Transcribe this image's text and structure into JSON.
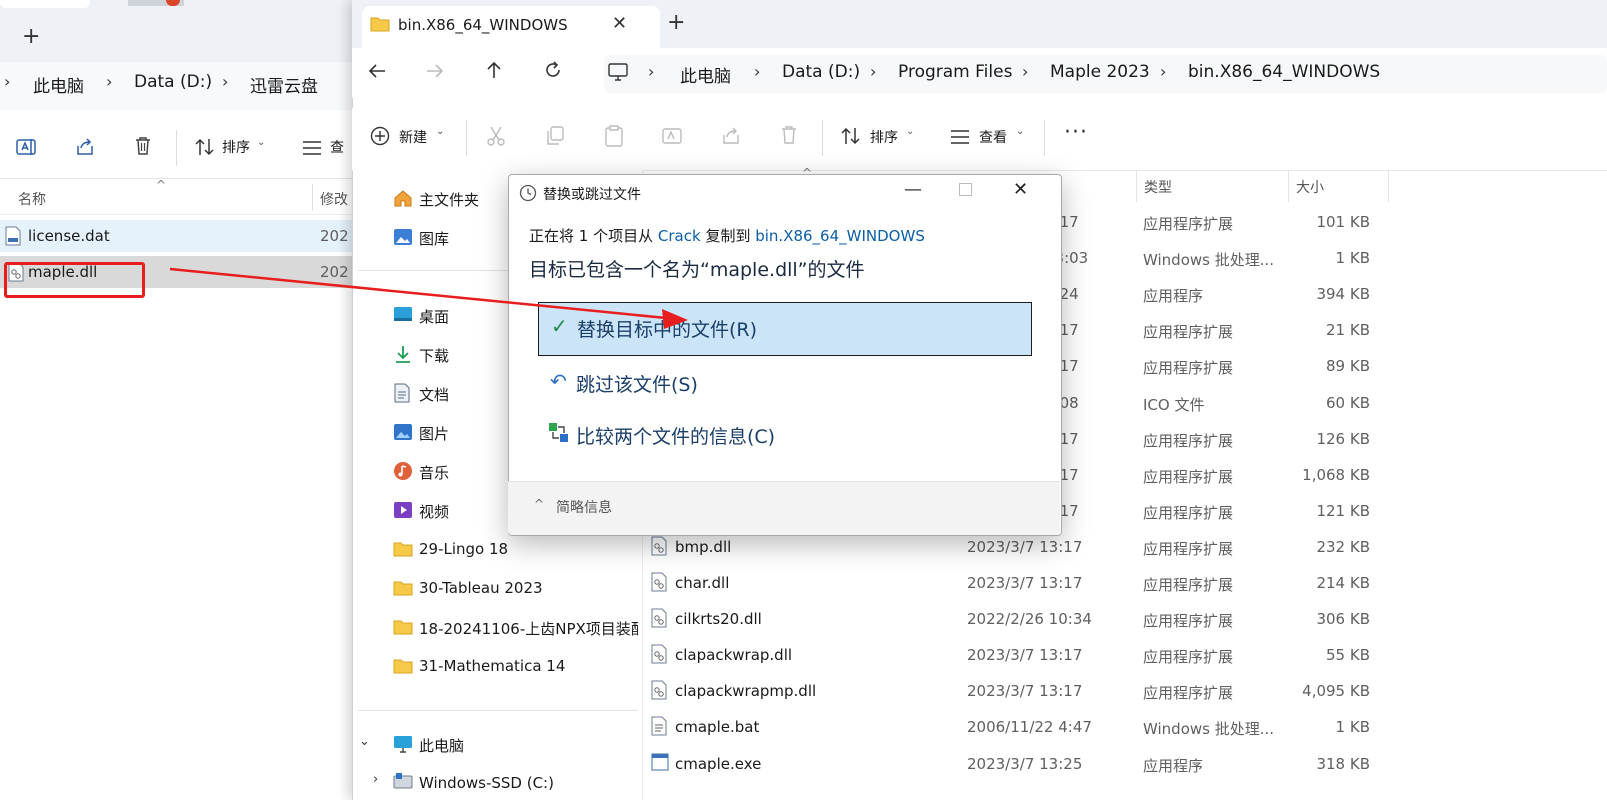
{
  "left_window": {
    "breadcrumb": [
      "此电脑",
      "Data (D:)",
      "迅雷云盘"
    ],
    "toolbar": {
      "sort_label": "排序",
      "view_label_partial": "查"
    },
    "columns": {
      "name": "名称",
      "modified_partial": "修改"
    },
    "files": [
      {
        "name": "license.dat",
        "date_partial": "202"
      },
      {
        "name": "maple.dll",
        "date_partial": "202"
      }
    ]
  },
  "right_window": {
    "tab_title": "bin.X86_64_WINDOWS",
    "breadcrumb": [
      "此电脑",
      "Data (D:)",
      "Program Files",
      "Maple 2023",
      "bin.X86_64_WINDOWS"
    ],
    "toolbar": {
      "new_label": "新建",
      "sort_label": "排序",
      "view_label": "查看"
    },
    "columns": {
      "type": "类型",
      "size": "大小"
    },
    "nav_pane": {
      "quick": [
        {
          "label": "主文件夹",
          "icon": "home-icon"
        },
        {
          "label": "图库",
          "icon": "gallery-icon"
        }
      ],
      "pinned": [
        {
          "label": "桌面",
          "icon": "desktop-icon"
        },
        {
          "label": "下载",
          "icon": "download-icon"
        },
        {
          "label": "文档",
          "icon": "document-icon"
        },
        {
          "label": "图片",
          "icon": "pictures-icon"
        },
        {
          "label": "音乐",
          "icon": "music-icon"
        },
        {
          "label": "视频",
          "icon": "video-icon"
        },
        {
          "label": "29-Lingo 18",
          "icon": "folder-icon"
        },
        {
          "label": "30-Tableau 2023",
          "icon": "folder-icon"
        },
        {
          "label": "18-20241106-上齿NPX项目装配",
          "icon": "folder-icon"
        },
        {
          "label": "31-Mathematica 14",
          "icon": "folder-icon"
        }
      ],
      "this_pc": "此电脑",
      "drive_partial": "Windows-SSD (C:)"
    },
    "files": [
      {
        "name": "",
        "date": "3:17",
        "type": "应用程序扩展",
        "size": "101 KB"
      },
      {
        "name": "",
        "date": "23:03",
        "type": "Windows 批处理...",
        "size": "1 KB"
      },
      {
        "name": "",
        "date": "3:24",
        "type": "应用程序",
        "size": "394 KB"
      },
      {
        "name": "",
        "date": "3:17",
        "type": "应用程序扩展",
        "size": "21 KB"
      },
      {
        "name": "",
        "date": "3:17",
        "type": "应用程序扩展",
        "size": "89 KB"
      },
      {
        "name": "",
        "date": "2:08",
        "type": "ICO 文件",
        "size": "60 KB"
      },
      {
        "name": "",
        "date": "3:17",
        "type": "应用程序扩展",
        "size": "126 KB"
      },
      {
        "name": "",
        "date": "3:17",
        "type": "应用程序扩展",
        "size": "1,068 KB"
      },
      {
        "name": "",
        "date": "3:17",
        "type": "应用程序扩展",
        "size": "121 KB"
      },
      {
        "name": "bmp.dll",
        "date": "2023/3/7 13:17",
        "type": "应用程序扩展",
        "size": "232 KB"
      },
      {
        "name": "char.dll",
        "date": "2023/3/7 13:17",
        "type": "应用程序扩展",
        "size": "214 KB"
      },
      {
        "name": "cilkrts20.dll",
        "date": "2022/2/26 10:34",
        "type": "应用程序扩展",
        "size": "306 KB"
      },
      {
        "name": "clapackwrap.dll",
        "date": "2023/3/7 13:17",
        "type": "应用程序扩展",
        "size": "55 KB"
      },
      {
        "name": "clapackwrapmp.dll",
        "date": "2023/3/7 13:17",
        "type": "应用程序扩展",
        "size": "4,095 KB"
      },
      {
        "name": "cmaple.bat",
        "date": "2006/11/22 4:47",
        "type": "Windows 批处理...",
        "size": "1 KB"
      },
      {
        "name": "cmaple.exe",
        "date": "2023/3/7 13:25",
        "type": "应用程序",
        "size": "318 KB"
      }
    ]
  },
  "dialog": {
    "title": "替换或跳过文件",
    "copy_prefix": "正在将 1 个项目从",
    "source": "Crack",
    "copy_mid": "复制到",
    "dest": "bin.X86_64_WINDOWS",
    "heading": "目标已包含一个名为“maple.dll”的文件",
    "options": {
      "replace": "替换目标中的文件(R)",
      "skip": "跳过该文件(S)",
      "compare": "比较两个文件的信息(C)"
    },
    "less_info": "简略信息"
  },
  "colors": {
    "highlight": "#cce4f7",
    "annotation_red": "#e81e1e",
    "link": "#0b5ea8"
  }
}
